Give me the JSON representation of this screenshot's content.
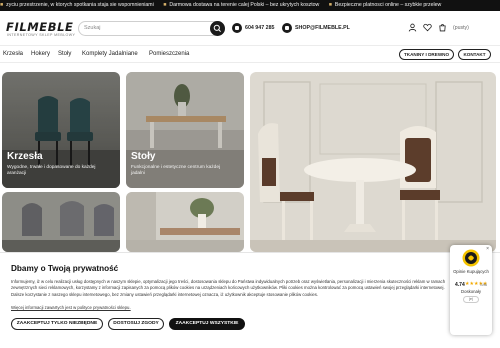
{
  "ticker": {
    "items": [
      "zyciu przestrzenie, w ktorych spotkania staja sie wspomnieniami",
      "Darmowa dostawa na terenie calej Polski – bez ukrytych kosztow",
      "Bezpieczne platnosci online – szybkie przelew"
    ]
  },
  "header": {
    "logo": "FILMEBLE",
    "logo_tagline": "INTERNETOWY SKLEP MEBLOWY",
    "search_placeholder": "Szukaj",
    "phone": "604 947 285",
    "email": "SHOP@FILMEBLE.PL",
    "cart_label": "(pusty)"
  },
  "nav": {
    "items": [
      "Krzesła",
      "Hokery",
      "Stoły",
      "Komplety Jadalniane",
      "Pomieszczenia"
    ],
    "buttons": [
      "TKANINY I DREWNO",
      "KONTAKT"
    ]
  },
  "tiles": [
    {
      "title": "Krzesła",
      "subtitle": "Wygodne, trwałe i dopasowane do każdej aranżacji"
    },
    {
      "title": "Stoły",
      "subtitle": "Funkcjonalne i estetyczne centrum każdej jadalni"
    }
  ],
  "consent": {
    "title": "Dbamy o Twoją prywatność",
    "text": "Informujemy, iż w celu realizacji usług dostępnych w naszym sklepie, optymalizacji jego treści, dostosowania sklepu do Państwa indywidualnych potrzeb oraz wyświetlania, personalizacji i mierzenia skuteczności reklam w ramach zewnętrznych sieci reklamowych, korzystamy z informacji zapisanych za pomocą plików cookies na urządzeniach końcowych użytkowników. Pliki cookies można kontrolować za pomocą ustawień swojej przeglądarki internetowej. Dalsze korzystanie z naszego sklepu internetowego, bez zmiany ustawień przeglądarki internetowej oznacza, iż użytkownik akceptuje stosowanie plików cookies.",
    "link": "Więcej informacji zawartych jest w polityce prywatności sklepu.",
    "buttons": {
      "necessary": "ZAAKCEPTUJ TYLKO NIEZBĘDNE",
      "customize": "DOSTOSUJ ZGODY",
      "accept_all": "ZAAKCEPTUJ WSZYSTKIE"
    }
  },
  "trust_badge": {
    "line1": "Opinie Kupujących",
    "score": "4.74",
    "stars": "★★★★★",
    "count": "/196",
    "line2": "Doskonały",
    "toggle": "(e)",
    "rating_value": 4.74
  },
  "colors": {
    "ticker_bg": "#111111",
    "primary_dark": "#111111",
    "badge_star": "#f2a900"
  }
}
